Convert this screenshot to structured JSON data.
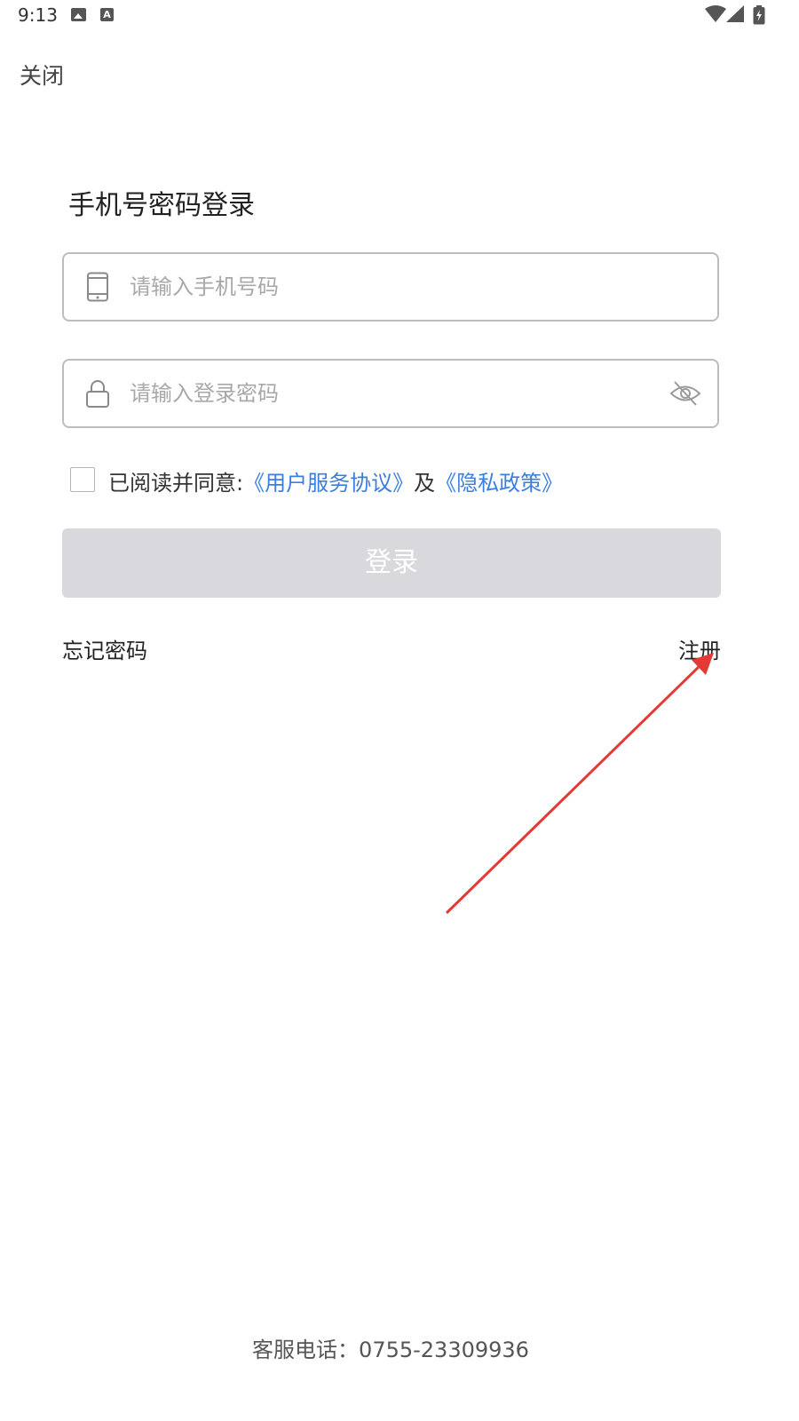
{
  "status_bar": {
    "time": "9:13",
    "icons": [
      "image-icon",
      "a-icon",
      "wifi-icon",
      "signal-icon",
      "battery-icon"
    ]
  },
  "header": {
    "close_label": "关闭"
  },
  "main": {
    "title": "手机号密码登录",
    "phone_field": {
      "placeholder": "请输入手机号码",
      "value": "",
      "icon": "phone-icon"
    },
    "password_field": {
      "placeholder": "请输入登录密码",
      "value": "",
      "icon": "lock-icon",
      "toggle_icon": "eye-off-icon"
    },
    "agreement": {
      "checked": false,
      "prefix": "已阅读并同意:",
      "terms_link": "《用户服务协议》",
      "joiner": "及",
      "privacy_link": "《隐私政策》"
    },
    "login_button": "登录",
    "forgot_password": "忘记密码",
    "register": "注册"
  },
  "footer": {
    "service_phone": "客服电话：0755-23309936"
  },
  "colors": {
    "link": "#3a7fe0",
    "button_disabled": "#d9d9dd",
    "annotation_arrow": "#e53935"
  }
}
